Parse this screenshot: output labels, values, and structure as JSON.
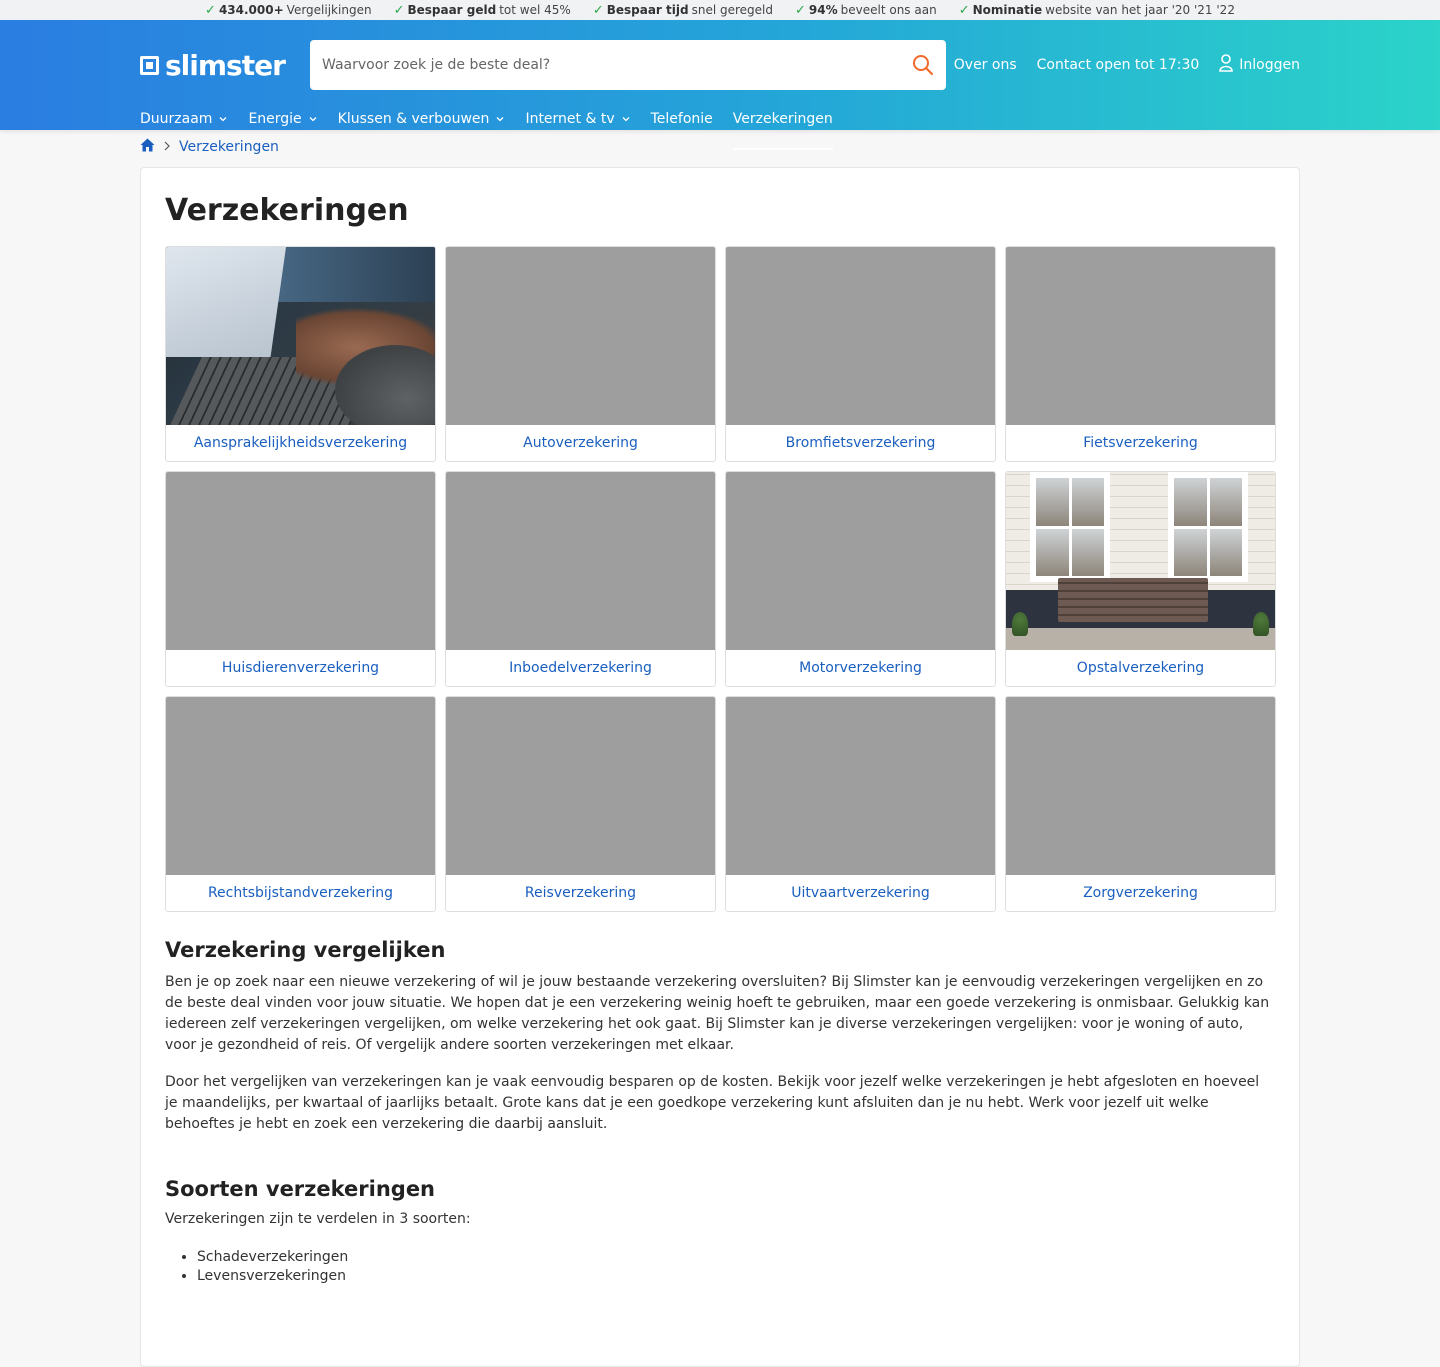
{
  "usps": [
    {
      "bold": "434.000+",
      "text": "Vergelijkingen"
    },
    {
      "bold": "Bespaar geld",
      "text": "tot wel 45%"
    },
    {
      "bold": "Bespaar tijd",
      "text": "snel geregeld"
    },
    {
      "bold": "94%",
      "text": "beveelt ons aan"
    },
    {
      "bold": "Nominatie",
      "text": "website van het jaar '20 '21 '22"
    }
  ],
  "header": {
    "logo_text": "slimster",
    "search_placeholder": "Waarvoor zoek je de beste deal?",
    "links": {
      "about": "Over ons",
      "contact": "Contact open tot 17:30",
      "login": "Inloggen"
    }
  },
  "nav": [
    {
      "label": "Duurzaam",
      "has_dropdown": true
    },
    {
      "label": "Energie",
      "has_dropdown": true
    },
    {
      "label": "Klussen & verbouwen",
      "has_dropdown": true
    },
    {
      "label": "Internet & tv",
      "has_dropdown": true
    },
    {
      "label": "Telefonie",
      "has_dropdown": false
    },
    {
      "label": "Verzekeringen",
      "has_dropdown": false,
      "active": true
    }
  ],
  "breadcrumb": {
    "current": "Verzekeringen"
  },
  "main": {
    "title": "Verzekeringen",
    "tiles": [
      {
        "label": "Aansprakelijkheidsverzekering"
      },
      {
        "label": "Autoverzekering"
      },
      {
        "label": "Bromfietsverzekering"
      },
      {
        "label": "Fietsverzekering"
      },
      {
        "label": "Huisdierenverzekering"
      },
      {
        "label": "Inboedelverzekering"
      },
      {
        "label": "Motorverzekering"
      },
      {
        "label": "Opstalverzekering"
      },
      {
        "label": "Rechtsbijstandverzekering"
      },
      {
        "label": "Reisverzekering"
      },
      {
        "label": "Uitvaartverzekering"
      },
      {
        "label": "Zorgverzekering"
      }
    ],
    "section1_title": "Verzekering vergelijken",
    "section1_p1": "Ben je op zoek naar een nieuwe verzekering of wil je jouw bestaande verzekering oversluiten? Bij Slimster kan je eenvoudig verzekeringen vergelijken en zo de beste deal vinden voor jouw situatie. We hopen dat je een verzekering weinig hoeft te gebruiken, maar een goede verzekering is onmisbaar. Gelukkig kan iedereen zelf verzekeringen vergelijken, om welke verzekering het ook gaat. Bij Slimster kan je diverse verzekeringen vergelijken: voor je woning of auto, voor je gezondheid of reis. Of vergelijk andere soorten verzekeringen met elkaar.",
    "section1_p2": "Door het vergelijken van verzekeringen kan je vaak eenvoudig besparen op de kosten. Bekijk voor jezelf welke verzekeringen je hebt afgesloten en hoeveel je maandelijks, per kwartaal of jaarlijks betaalt. Grote kans dat je een goedkope verzekering kunt afsluiten dan je nu hebt. Werk voor jezelf uit welke behoeftes je hebt en zoek een verzekering die daarbij aansluit.",
    "section2_title": "Soorten verzekeringen",
    "section2_intro": "Verzekeringen zijn te verdelen in 3 soorten:",
    "section2_list": [
      "Schadeverzekeringen",
      "Levensverzekeringen"
    ]
  },
  "colors": {
    "link": "#1a5fbf",
    "check": "#2aa84a",
    "search_icon": "#f06a2b",
    "header_start": "#2a7de1",
    "header_end": "#2bd3c9"
  }
}
